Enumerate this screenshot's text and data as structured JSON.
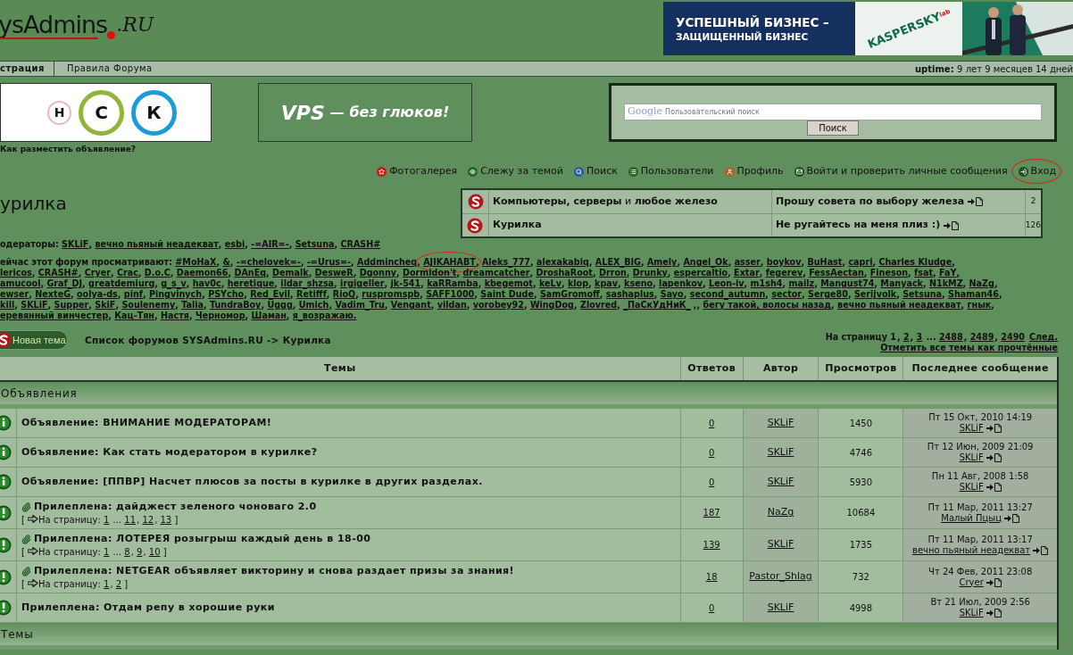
{
  "logo": {
    "text": "ysAdmins",
    "suffix": ".RU"
  },
  "banner": {
    "line1": "УСПЕШНЫЙ БИЗНЕС –",
    "line2": "ЗАЩИЩЕННЫЙ БИЗНЕС",
    "brand": "KASPERSKY",
    "brand_sub": "lab"
  },
  "nav": {
    "links": [
      {
        "label": "страция",
        "bold": true
      },
      {
        "label": "Правила Форума",
        "bold": false
      }
    ],
    "uptime_label": "uptime:",
    "uptime": "9 лет 9 месяцев 14 дней"
  },
  "ads": {
    "letters": [
      {
        "letter": "Н",
        "color": "#e9b9b9"
      },
      {
        "letter": "С",
        "color": "#8fb63a"
      },
      {
        "letter": "К",
        "color": "#1b9bd8"
      }
    ],
    "vps": "VPS",
    "vps_tail": "— без глюков!",
    "link": "Как разместить объявление?"
  },
  "search": {
    "brand": "Google",
    "placeholder": "Пользовательский поиск",
    "button": "Поиск"
  },
  "toolbar": [
    {
      "label": "Фотогалерея",
      "circled": false
    },
    {
      "label": "Слежу за темой",
      "kind": "watch",
      "circled": false
    },
    {
      "label": "Поиск",
      "kind": "search",
      "circled": false
    },
    {
      "label": "Пользователи",
      "kind": "users",
      "circled": false
    },
    {
      "label": "Профиль",
      "kind": "profile",
      "circled": false
    },
    {
      "label": "Войти и проверить личные сообщения",
      "kind": "messages",
      "circled": false
    },
    {
      "label": "Вход",
      "kind": "login",
      "circled": true
    }
  ],
  "forum_title": "урилка",
  "subforums": [
    {
      "name": "**Компьютеры, серверы** и **любое железо**",
      "last": "Прошу совета по выбору железа",
      "count": "2"
    },
    {
      "name": "**Курилка**",
      "last": "Не ругайтесь на меня плиз :)",
      "count": "126"
    }
  ],
  "moderators": {
    "label": "одераторы:",
    "separator": ", ",
    "names": [
      "SKLiF",
      "вечно пьяный неадекват",
      "esbi",
      "-=AIR=-",
      "Setsuna",
      "CRASH#"
    ]
  },
  "viewers": {
    "label": "ейчас этот форум просматривают:",
    "separator": ", ",
    "lines": [
      [
        "#MoHaX",
        "&",
        "-=chelovek=-",
        "-=Urus=-",
        "Addmincheq",
        {
          "name": "AJIKAHABT",
          "circled": true
        },
        "Aleks_777",
        "alexakabiq",
        "ALEX_BIG",
        "Amely",
        "Angel_Ok",
        "asser",
        "boykov",
        "BuHast",
        "capri",
        "Charles Kludge",
        {
          "text": ","
        }
      ],
      [
        "lericos",
        "CRASH#",
        "Cryer",
        "Crac",
        "D.o.C",
        "Daemon66",
        "DAnEq",
        "Demalk",
        "DesweR",
        "Dgonny",
        "Dormidon't",
        "dreamcatcher",
        "DroshaRoot",
        "Drron",
        "Drunky",
        "espercaltio",
        "Extar",
        "fegerev",
        "FessAectan",
        "Fineson",
        "fsat",
        "FaY",
        {
          "text": ","
        }
      ],
      [
        "amucool",
        "Graf_DJ",
        "greatdemiurg",
        "g_s_v",
        "hav0c",
        "heretique",
        "ildar_shzsa",
        "irgigeller",
        "jk-541",
        "kaRRamba",
        "kbegemot",
        "keLv",
        "klop",
        "kpav",
        "kseno",
        "lapenkov",
        "Leon-iv",
        "m1sh4",
        "mailz",
        "Mangust74",
        "Manyack",
        "N1kMZ",
        "NaZg",
        {
          "text": ","
        }
      ],
      [
        "ewser",
        "NexteG",
        "oolya-ds",
        "pinf",
        "Pingvinych",
        "PSYcho",
        "Red_Evil",
        "Retifff",
        "RioQ",
        "ruspromspb",
        "SAFF1000",
        "Saint Dude",
        "SamGromoff",
        "sashaplus",
        "Sayo",
        "second_autumn",
        "sector",
        "Serge80",
        "Serijvolk",
        "Setsuna",
        "Shaman46",
        {
          "text": ","
        }
      ],
      [
        "kill",
        "SKLiF",
        "Supper",
        "SkiF",
        "Soulenemy",
        "Talia",
        "TundraBoy",
        "Uggg",
        "Umich",
        "Vadim_Tru",
        "Vengant",
        "vildan",
        "vorobey92",
        "WingDog",
        "Zlovred",
        {
          "name": "_ПаСкУдНиК_",
          "suffix": " ,"
        },
        "бегу такой, волосы назад",
        "вечно пьяный неадекват",
        "гнык",
        {
          "text": ","
        }
      ],
      [
        "еревянный винчестер",
        "Кац-Тян",
        "Настя",
        "Черномор",
        "Шаман",
        "я_возражаю."
      ]
    ]
  },
  "new_topic": "Новая тема",
  "breadcrumb": "Список форумов SYSAdmins.RU -> Курилка",
  "pagination": {
    "label": "На страницу",
    "tokens": [
      {
        "text": "1",
        "kind": "current"
      },
      {
        "text": ", ",
        "kind": "text"
      },
      {
        "text": "2",
        "kind": "link"
      },
      {
        "text": ", ",
        "kind": "text"
      },
      {
        "text": "3",
        "kind": "link"
      },
      {
        "text": " ... ",
        "kind": "text"
      },
      {
        "text": "2488",
        "kind": "link"
      },
      {
        "text": ", ",
        "kind": "text"
      },
      {
        "text": "2489",
        "kind": "link"
      },
      {
        "text": ", ",
        "kind": "text"
      },
      {
        "text": "2490",
        "kind": "link"
      }
    ],
    "next": "След.",
    "mark_read": "Отметить все темы как прочтённые"
  },
  "table": {
    "columns": [
      "Темы",
      "Ответов",
      "Автор",
      "Просмотров",
      "Последнее сообщение"
    ],
    "sections": [
      {
        "title": "Объявления",
        "rows": [
          {
            "kind": "announcement",
            "attached": false,
            "title": "Объявление: ВНИМАНИЕ МОДЕРАТОРАМ!",
            "replies": "0",
            "author": "SKLiF",
            "views": "1450",
            "last_date": "Пт 15 Окт, 2010 14:19",
            "last_author": "SKLiF"
          },
          {
            "kind": "announcement",
            "attached": false,
            "title": "Объявление: Как стать модератором в курилке?",
            "replies": "0",
            "author": "SKLiF",
            "views": "4746",
            "last_date": "Пт 12 Июн, 2009 21:09",
            "last_author": "SKLiF"
          },
          {
            "kind": "announcement",
            "attached": false,
            "title": "Объявление: [ППВР] Насчет плюсов за посты в курилке в других разделах.",
            "replies": "0",
            "author": "SKLiF",
            "views": "5930",
            "last_date": "Пн 11 Авг, 2008 1:58",
            "last_author": "SKLiF"
          },
          {
            "kind": "sticky",
            "attached": true,
            "title": "Прилеплена: дайджест зеленого чоноваго 2.0",
            "pages": {
              "open": "[",
              "label": "На страницу:",
              "tokens": [
                {
                  "text": "1",
                  "kind": "link"
                },
                {
                  "text": " ... ",
                  "kind": "text"
                },
                {
                  "text": "11",
                  "kind": "link"
                },
                {
                  "text": ", ",
                  "kind": "text"
                },
                {
                  "text": "12",
                  "kind": "link"
                },
                {
                  "text": ", ",
                  "kind": "text"
                },
                {
                  "text": "13",
                  "kind": "link"
                }
              ],
              "close": "]"
            },
            "replies": "187",
            "author": "NaZg",
            "views": "10684",
            "last_date": "Пт 11 Мар, 2011 13:27",
            "last_author": "Малый Пцыц"
          },
          {
            "kind": "sticky",
            "attached": true,
            "title": "Прилеплена: ЛОТЕРЕЯ розыгрыш каждый день в 18-00",
            "pages": {
              "open": "[",
              "label": "На страницу:",
              "tokens": [
                {
                  "text": "1",
                  "kind": "link"
                },
                {
                  "text": " ... ",
                  "kind": "text"
                },
                {
                  "text": "8",
                  "kind": "link"
                },
                {
                  "text": ", ",
                  "kind": "text"
                },
                {
                  "text": "9",
                  "kind": "link"
                },
                {
                  "text": ", ",
                  "kind": "text"
                },
                {
                  "text": "10",
                  "kind": "link"
                }
              ],
              "close": "]"
            },
            "replies": "139",
            "author": "SKLiF",
            "views": "1735",
            "last_date": "Пт 11 Мар, 2011 13:17",
            "last_author": "вечно пьяный неадекват"
          },
          {
            "kind": "sticky",
            "attached": true,
            "title": "Прилеплена: NETGEAR объявляет викторину и снова раздает призы за знания!",
            "pages": {
              "open": "[",
              "label": "На страницу:",
              "tokens": [
                {
                  "text": "1",
                  "kind": "link"
                },
                {
                  "text": ", ",
                  "kind": "text"
                },
                {
                  "text": "2",
                  "kind": "link"
                }
              ],
              "close": "]"
            },
            "replies": "18",
            "author": "Pastor_Shlag",
            "views": "732",
            "last_date": "Чт 24 Фев, 2011 23:08",
            "last_author": "Cryer"
          },
          {
            "kind": "sticky",
            "attached": false,
            "title": "Прилеплена: Отдам репу в хорошие руки",
            "replies": "0",
            "author": "SKLiF",
            "views": "4998",
            "last_date": "Вт 21 Июл, 2009 2:56",
            "last_author": "SKLiF"
          }
        ]
      },
      {
        "title": "Темы"
      }
    ]
  }
}
